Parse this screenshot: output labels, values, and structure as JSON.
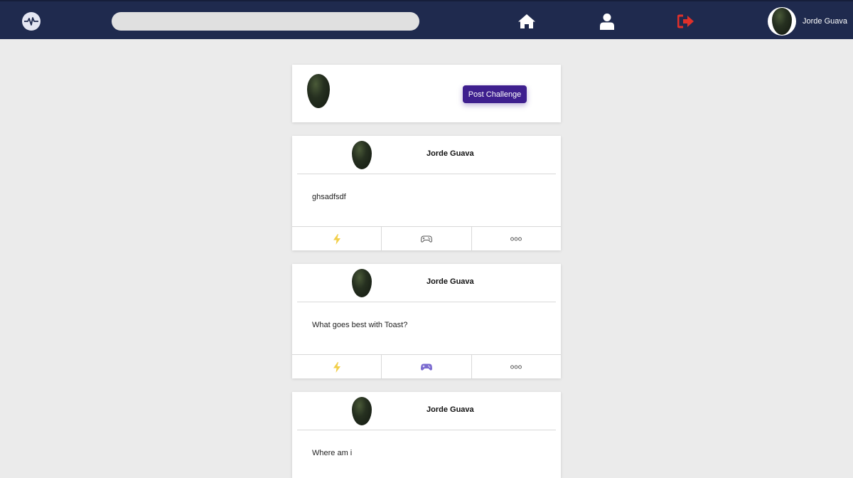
{
  "navbar": {
    "logo_icon": "pulse-icon",
    "search": {
      "value": "",
      "placeholder": ""
    },
    "home_icon": "home-icon",
    "profile_icon": "user-icon",
    "logout_icon": "sign-out-icon",
    "username": "Jorde Guava",
    "colors": {
      "background": "#1f2a4e",
      "logout": "#e0302a"
    }
  },
  "composer": {
    "button_label": "Post Challenge",
    "button_color": "#3e1f8e"
  },
  "posts": [
    {
      "author": "Jorde Guava",
      "text": "ghsadfsdf",
      "game_active": false
    },
    {
      "author": "Jorde Guava",
      "text": "What goes best with Toast?",
      "game_active": true
    },
    {
      "author": "Jorde Guava",
      "text": "Where am i"
    }
  ],
  "actions": {
    "bolt_icon": "lightning-icon",
    "game_icon": "gamepad-icon",
    "more_icon": "more-icon",
    "colors": {
      "bolt": "#f2cf4a",
      "game_inactive": "#555555",
      "game_active": "#7b6bd0"
    }
  }
}
